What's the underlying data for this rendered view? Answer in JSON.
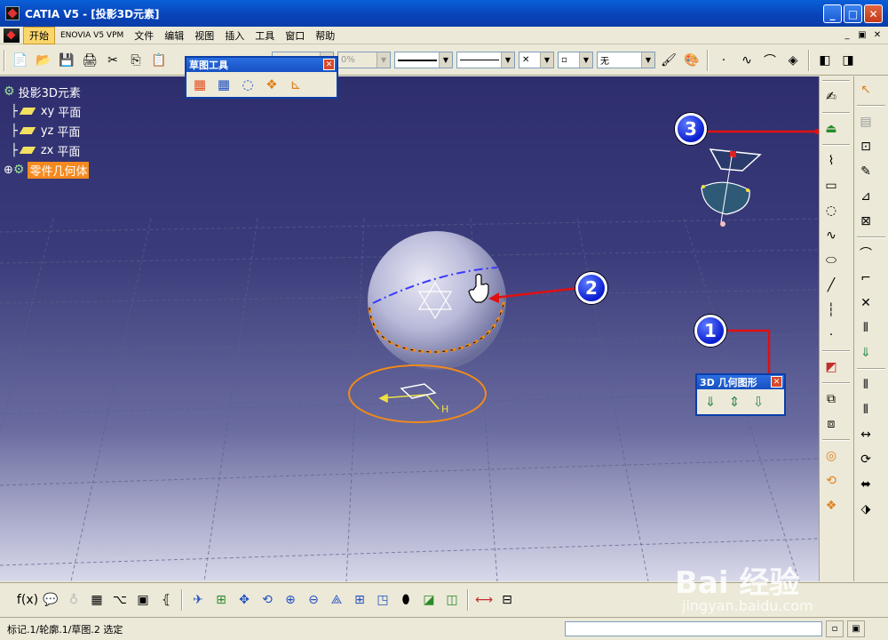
{
  "window": {
    "title": "CATIA V5 - [投影3D元素]",
    "min": "_",
    "max": "□",
    "close": "✕"
  },
  "menu": {
    "items": [
      "开始",
      "ENOVIA V5 VPM",
      "文件",
      "编辑",
      "视图",
      "插入",
      "工具",
      "窗口",
      "帮助"
    ]
  },
  "toolbar": {
    "combo_percent": "0%",
    "combo_none": "无"
  },
  "sketch_tools": {
    "title": "草图工具"
  },
  "geometry_3d": {
    "title": "3D 几何图形"
  },
  "tree": {
    "root": "投影3D元素",
    "xy_prefix": "xy",
    "xy_label": "平面",
    "yz_prefix": "yz",
    "yz_label": "平面",
    "zx_prefix": "zx",
    "zx_label": "平面",
    "body": "零件几何体"
  },
  "callouts": [
    "1",
    "2",
    "3"
  ],
  "viewport": {
    "axis_label": "H"
  },
  "status": {
    "text": "标记.1/轮廓.1/草图.2 选定"
  },
  "watermark": {
    "brand": "Bai 经验",
    "url": "jingyan.baidu.com"
  },
  "colors": {
    "accent_orange": "#f48a1f",
    "callout_blue": "#0b1fd0",
    "arrow_red": "#e01010"
  }
}
